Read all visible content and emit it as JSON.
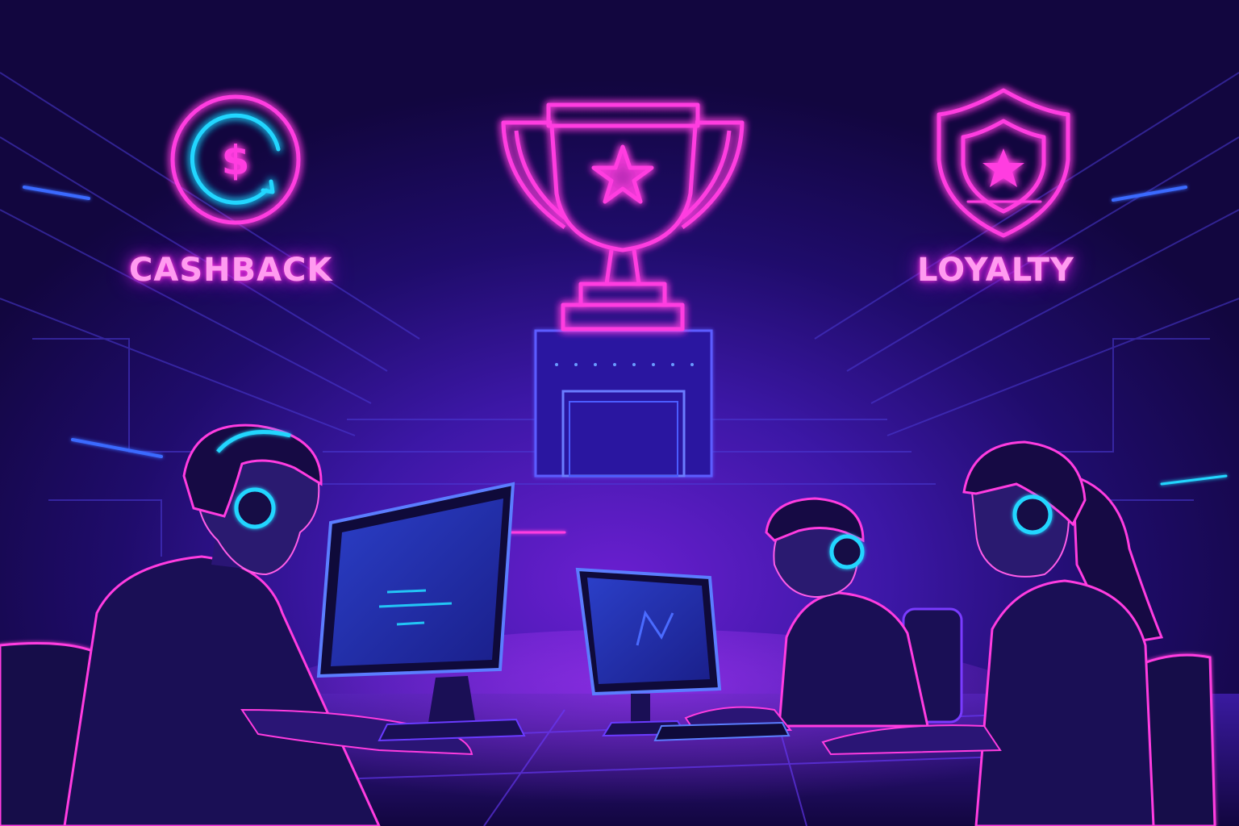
{
  "scene": {
    "labels": {
      "cashback": "CASHBACK",
      "loyalty": "LOYALTY"
    },
    "icons": {
      "cashback": "cashback-dollar-cycle-icon",
      "trophy": "trophy-star-icon",
      "loyalty": "shield-star-icon"
    },
    "colors": {
      "background": "#12063f",
      "neon_pink": "#ff3ce0",
      "neon_cyan": "#23d6ff",
      "neon_blue": "#3a6bff",
      "label_text": "#ff9bf0"
    }
  }
}
